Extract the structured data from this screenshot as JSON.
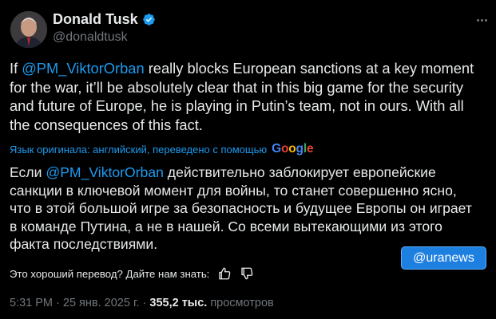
{
  "author": {
    "name": "Donald Tusk",
    "handle": "@donaldtusk",
    "verified_icon": "verified-badge-icon",
    "accent": "#1d9bf0"
  },
  "tweet": {
    "text_before": "If ",
    "mention": "@PM_ViktorOrban",
    "text_after": " really blocks European sanctions at a key moment for the war, it’ll be absolutely clear that in this big game for the security and future of Europe, he is playing in Putin’s team, not in ours. With all the consequences of this fact."
  },
  "translation": {
    "note": "Язык оригинала: английский, переведено с помощью",
    "provider": [
      "G",
      "o",
      "o",
      "g",
      "l",
      "e"
    ],
    "text_before": "Если ",
    "mention": "@PM_ViktorOrban",
    "text_after": " действительно заблокирует европейские санкции в ключевой момент для войны, то станет совершенно ясно, что в этой большой игре за безопасность и будущее Европы он играет в команде Путина, а не в нашей. Со всеми вытекающими из этого факта последствиями."
  },
  "watermark": "@uranews",
  "feedback": {
    "question": "Это хороший перевод? Дайте нам знать:",
    "like_icon": "thumbs-up-icon",
    "dislike_icon": "thumbs-down-icon"
  },
  "meta": {
    "time": "5:31 PM",
    "sep1": " · ",
    "date": "25 янв. 2025 г.",
    "sep2": " · ",
    "views_count": "355,2 тыс.",
    "views_label": " просмотров"
  }
}
